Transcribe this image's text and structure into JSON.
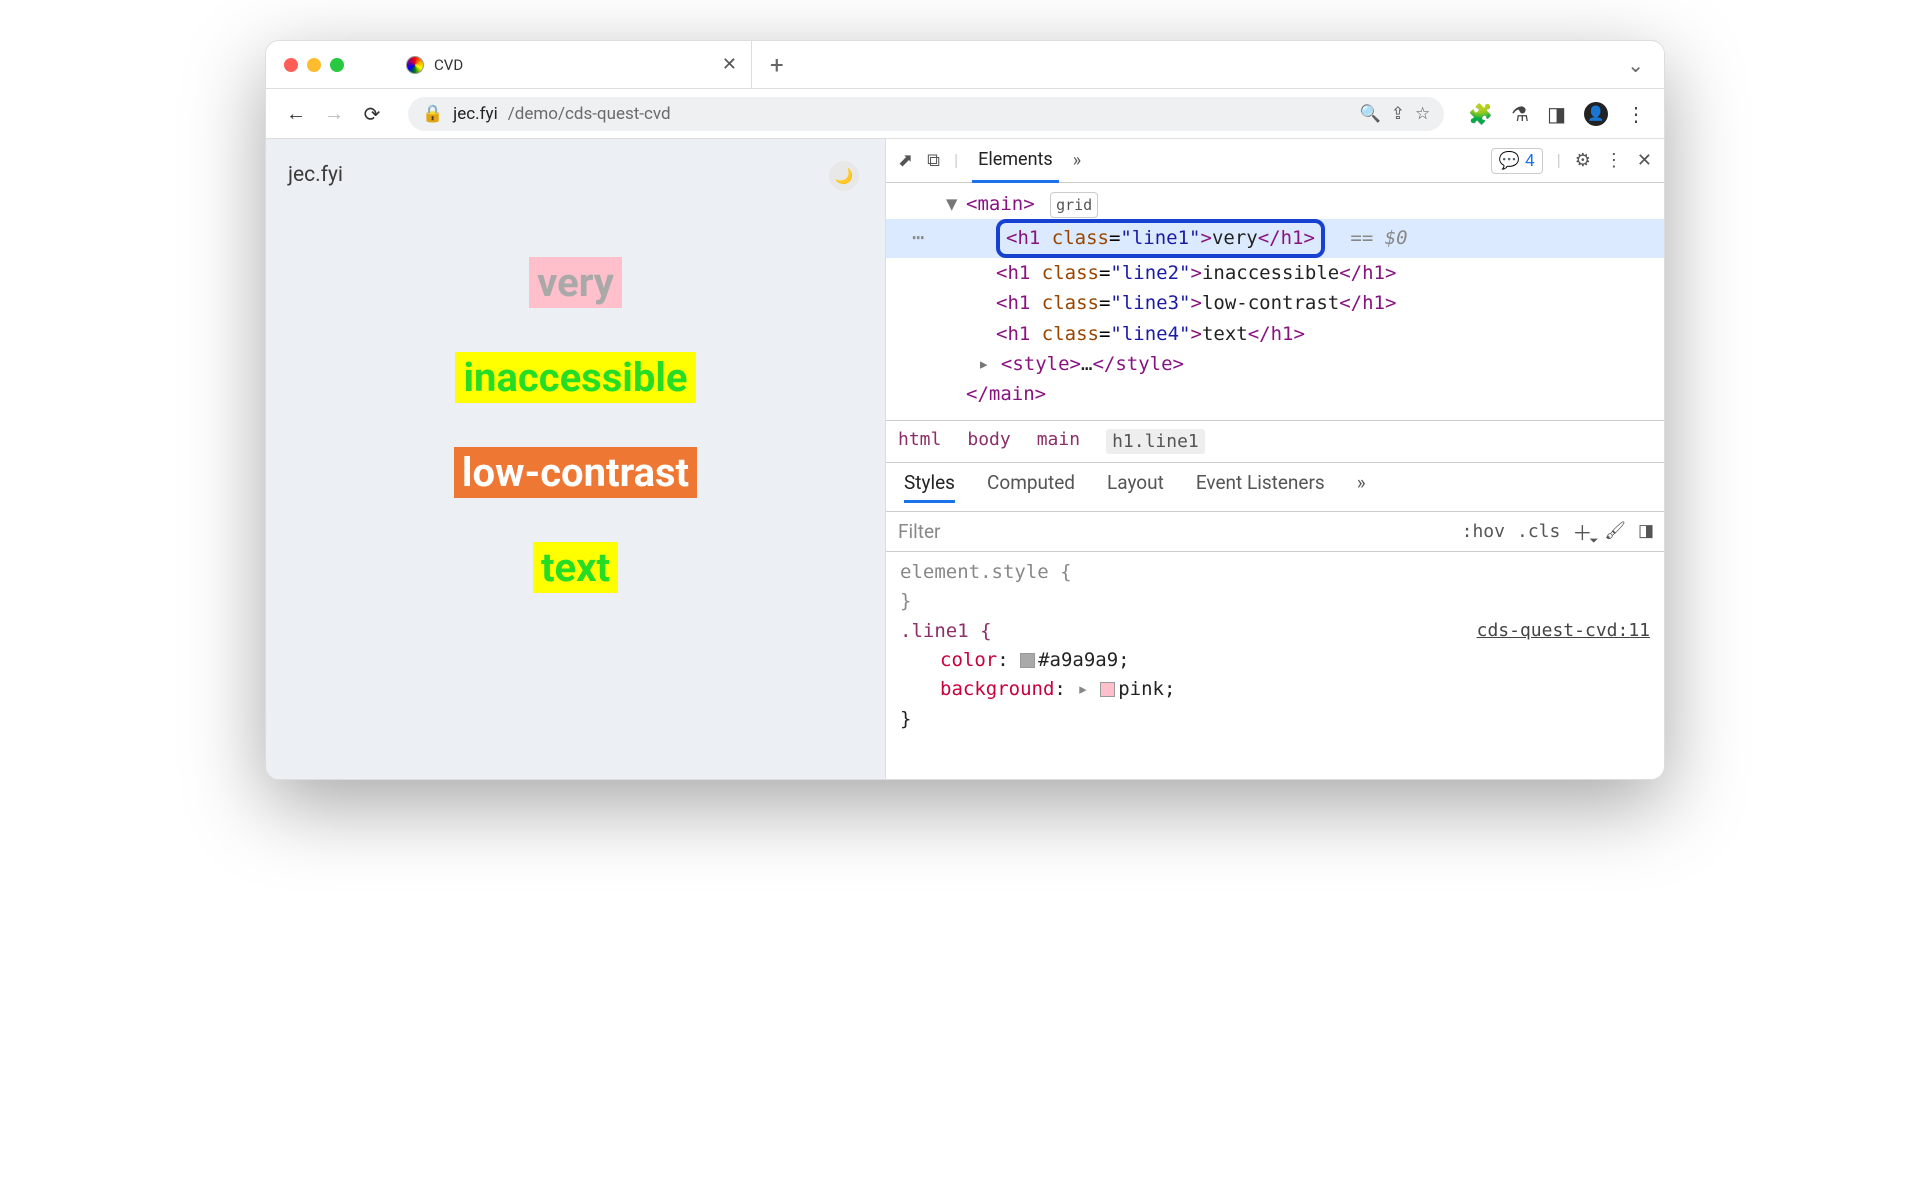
{
  "tab": {
    "title": "CVD"
  },
  "url": {
    "domain": "jec.fyi",
    "path": "/demo/cds-quest-cvd"
  },
  "page": {
    "site_name": "jec.fyi",
    "line1": "very",
    "line2": "inaccessible",
    "line3": "low-contrast",
    "line4": "text"
  },
  "devtools": {
    "panels": {
      "elements": "Elements"
    },
    "issues_count": "4",
    "dom": {
      "main_open": "<main>",
      "grid_badge": "grid",
      "h1_line1": {
        "open": "<h1 ",
        "class_attr": "class",
        "class_val": "\"line1\"",
        "gt": ">",
        "text": "very",
        "close": "</h1>",
        "eq0": "== $0"
      },
      "h1_line2": {
        "open": "<h1 ",
        "class_attr": "class",
        "class_val": "\"line2\"",
        "gt": ">",
        "text": "inaccessible",
        "close": "</h1>"
      },
      "h1_line3": {
        "open": "<h1 ",
        "class_attr": "class",
        "class_val": "\"line3\"",
        "gt": ">",
        "text": "low-contrast",
        "close": "</h1>"
      },
      "h1_line4": {
        "open": "<h1 ",
        "class_attr": "class",
        "class_val": "\"line4\"",
        "gt": ">",
        "text": "text",
        "close": "</h1>"
      },
      "style_open": "<style>",
      "style_ell": "…",
      "style_close": "</style>",
      "main_close": "</main>"
    },
    "breadcrumb": {
      "a": "html",
      "b": "body",
      "c": "main",
      "d": "h1.line1"
    },
    "style_tabs": {
      "styles": "Styles",
      "computed": "Computed",
      "layout": "Layout",
      "events": "Event Listeners"
    },
    "styles_toolbar": {
      "filter": "Filter",
      "hov": ":hov",
      "cls": ".cls"
    },
    "styles": {
      "element_style": "element.style {",
      "close": "}",
      "selector": ".line1 {",
      "source": "cds-quest-cvd:11",
      "prop1_name": "color",
      "prop1_val": "#a9a9a9",
      "prop2_name": "background",
      "prop2_val": "pink"
    }
  }
}
